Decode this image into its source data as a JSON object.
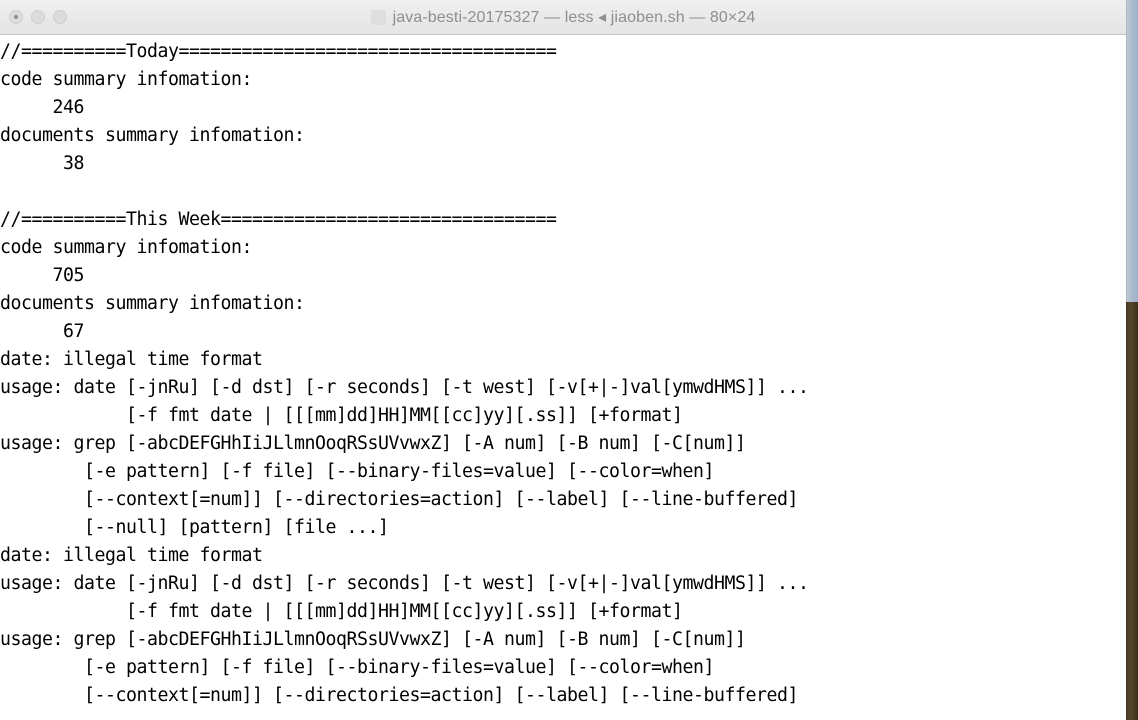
{
  "window": {
    "title": "java-besti-20175327 — less ◂ jiaoben.sh — 80×24",
    "proxy_icon": "document-icon",
    "traffic_lights": [
      {
        "name": "close-button",
        "label": "Close"
      },
      {
        "name": "minimize-button",
        "label": "Minimize"
      },
      {
        "name": "zoom-button",
        "label": "Zoom"
      }
    ],
    "colors": {
      "titlebar_bg": "#e9e9e9",
      "titlebar_text": "#8e8e8e",
      "terminal_bg": "#ffffff",
      "terminal_fg": "#000000",
      "desktop_strip_top": "#adbbcd",
      "desktop_strip_bottom": "#57452c"
    },
    "geometry": "80×24",
    "pager": "less",
    "file": "jiaoben.sh",
    "host": "java-besti-20175327"
  },
  "terminal": {
    "lines": [
      "//==========Today====================================",
      "code summary infomation:",
      "     246",
      "documents summary infomation:",
      "      38",
      "",
      "//==========This Week================================",
      "code summary infomation:",
      "     705",
      "documents summary infomation:",
      "      67",
      "date: illegal time format",
      "usage: date [-jnRu] [-d dst] [-r seconds] [-t west] [-v[+|-]val[ymwdHMS]] ...",
      "            [-f fmt date | [[[mm]dd]HH]MM[[cc]yy][.ss]] [+format]",
      "usage: grep [-abcDEFGHhIiJLlmnOoqRSsUVvwxZ] [-A num] [-B num] [-C[num]]",
      "        [-e pattern] [-f file] [--binary-files=value] [--color=when]",
      "        [--context[=num]] [--directories=action] [--label] [--line-buffered]",
      "        [--null] [pattern] [file ...]",
      "date: illegal time format",
      "usage: date [-jnRu] [-d dst] [-r seconds] [-t west] [-v[+|-]val[ymwdHMS]] ...",
      "            [-f fmt date | [[[mm]dd]HH]MM[[cc]yy][.ss]] [+format]",
      "usage: grep [-abcDEFGHhIiJLlmnOoqRSsUVvwxZ] [-A num] [-B num] [-C[num]]",
      "        [-e pattern] [-f file] [--binary-files=value] [--color=when]",
      "        [--context[=num]] [--directories=action] [--label] [--line-buffered]"
    ],
    "summary": {
      "today": {
        "header": "//==========Today====================================",
        "code_label": "code summary infomation:",
        "code_count": "246",
        "documents_label": "documents summary infomation:",
        "documents_count": "38"
      },
      "this_week": {
        "header": "//==========This Week================================",
        "code_label": "code summary infomation:",
        "code_count": "705",
        "documents_label": "documents summary infomation:",
        "documents_count": "67"
      }
    }
  }
}
